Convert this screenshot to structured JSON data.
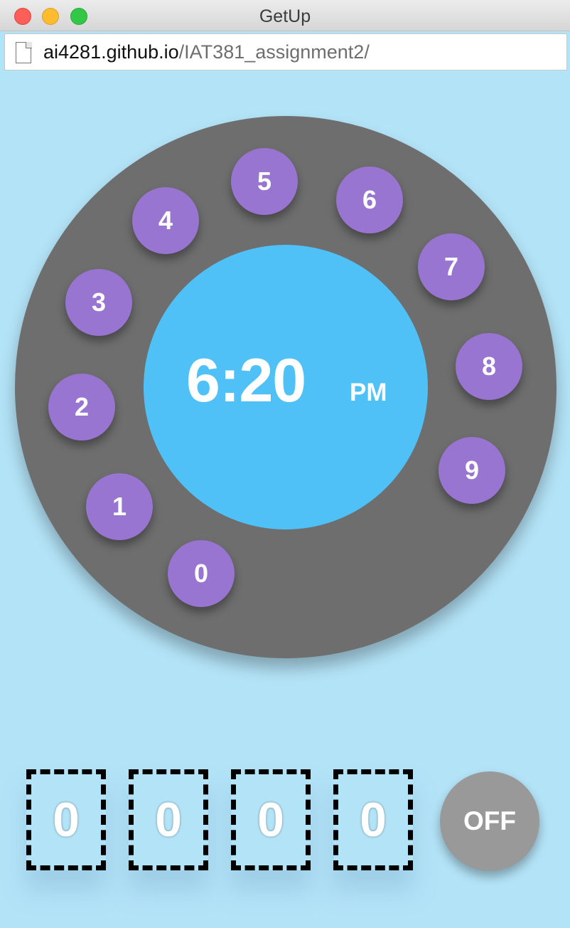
{
  "window": {
    "title": "GetUp"
  },
  "urlbar": {
    "domain": "ai4281.github.io",
    "path": "/IAT381_assignment2/"
  },
  "dial": {
    "digits": [
      "0",
      "1",
      "2",
      "3",
      "4",
      "5",
      "6",
      "7",
      "8",
      "9"
    ],
    "time": "6:20",
    "ampm": "PM"
  },
  "code": {
    "digits": [
      "0",
      "0",
      "0",
      "0"
    ],
    "off_label": "OFF"
  },
  "colors": {
    "background": "#b3e3f7",
    "dial": "#6e6e6e",
    "digit_button": "#9875d0",
    "face": "#4fc1f6",
    "off_button": "#999999"
  }
}
